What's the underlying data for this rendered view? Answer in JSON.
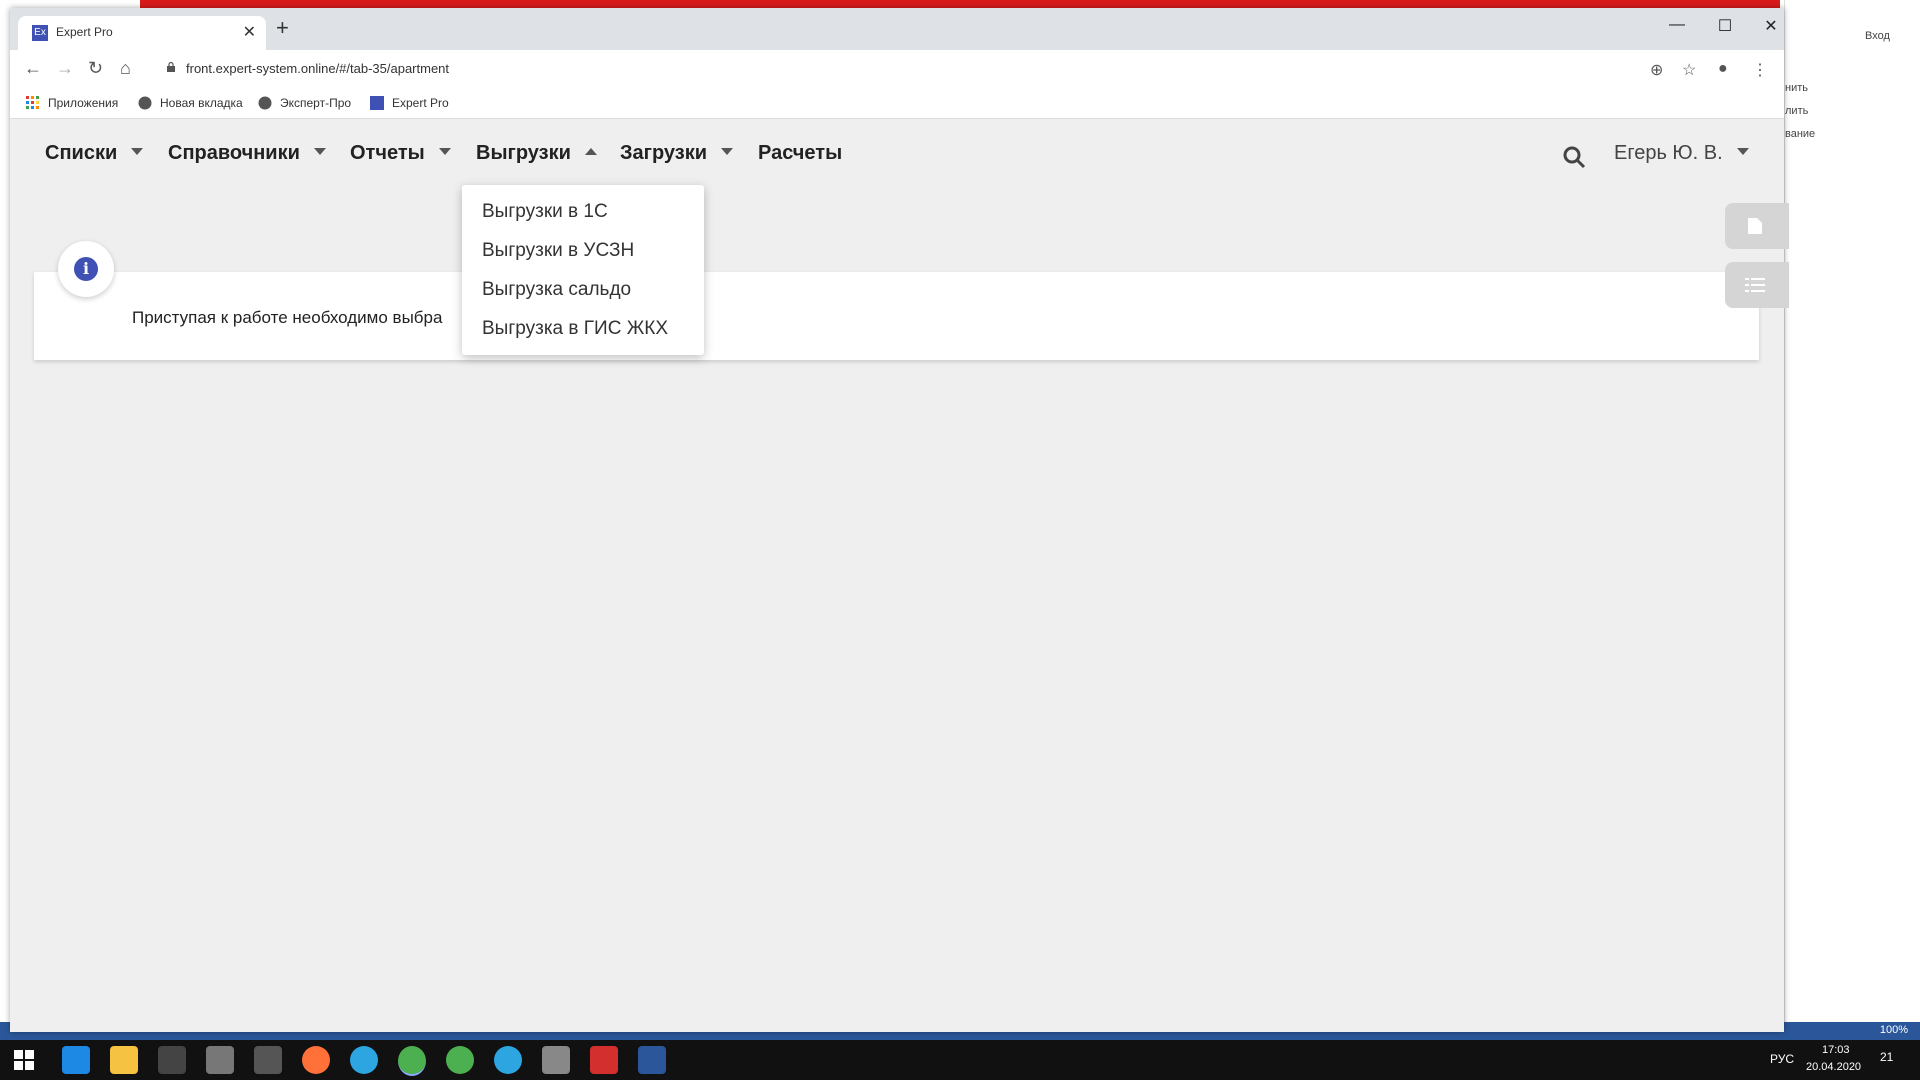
{
  "background_app": {
    "signin_label": "Вход",
    "snippet_1": "нить",
    "snippet_2": "лить",
    "snippet_3": "вание",
    "zoom": "100%"
  },
  "browser": {
    "tab_title": "Expert Pro",
    "favicon_text": "Ex",
    "url": "front.expert-system.online/#/tab-35/apartment",
    "bookmarks": [
      {
        "label": "Приложения",
        "icon": "apps-icon"
      },
      {
        "label": "Новая вкладка",
        "icon": "globe-icon"
      },
      {
        "label": "Эксперт-Про",
        "icon": "globe-icon"
      },
      {
        "label": "Expert Pro",
        "icon": "expert-favicon"
      }
    ]
  },
  "page": {
    "menu": [
      {
        "label": "Списки"
      },
      {
        "label": "Справочники"
      },
      {
        "label": "Отчеты"
      },
      {
        "label": "Выгрузки"
      },
      {
        "label": "Загрузки"
      },
      {
        "label": "Расчеты"
      }
    ],
    "user": "Егерь Ю. В.",
    "dropdown": [
      "Выгрузки в 1С",
      "Выгрузки в УСЗН",
      "Выгрузка сальдо",
      "Выгрузка в ГИС ЖКХ"
    ],
    "info_text": "Приступая к работе необходимо выбра",
    "info_icon_letter": "i"
  },
  "taskbar": {
    "lang": "РУС",
    "time": "17:03",
    "date": "20.04.2020",
    "notifications": "21"
  },
  "colors": {
    "accent": "#3f51b5",
    "redbar": "#d81b1b",
    "taskbar": "#111111"
  }
}
